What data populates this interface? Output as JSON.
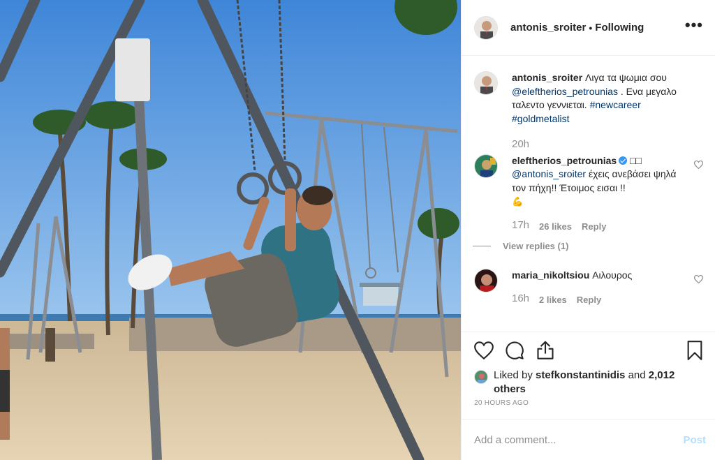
{
  "post": {
    "author": "antonis_sroiter",
    "follow_status": "Following",
    "more_label": "•••"
  },
  "caption": {
    "user": "antonis_sroiter",
    "text": "Λιγα τα ψωμια σου",
    "mention": "@eleftherios_petrounias",
    "text2": ". Ενα μεγαλο ταλεντο γεννιεται.",
    "tag1": "#newcareer",
    "tag2": "#goldmetalist",
    "time": "20h"
  },
  "comments": [
    {
      "user": "eleftherios_petrounias",
      "verified": true,
      "pre_text": "□□",
      "mention": "@antonis_sroiter",
      "text": "έχεις ανεβάσει ψηλά τον πήχη!! Έτοιμος εισαι !!",
      "emoji": "💪",
      "time": "17h",
      "likes": "26 likes",
      "reply": "Reply",
      "view_replies": "View replies (1)"
    },
    {
      "user": "maria_nikoltsiou",
      "text": "Αιλουρος",
      "time": "16h",
      "likes": "2 likes",
      "reply": "Reply"
    }
  ],
  "actions": {
    "icons": [
      "heart-icon",
      "comment-icon",
      "share-icon",
      "bookmark-icon"
    ]
  },
  "likes": {
    "prefix": "Liked by",
    "user": "stefkonstantinidis",
    "and": "and",
    "others": "2,012 others"
  },
  "timestamp": "20 HOURS AGO",
  "add_comment": {
    "placeholder": "Add a comment...",
    "post_label": "Post"
  },
  "colors": {
    "link": "#00376b",
    "meta": "#8e8e8e",
    "post_disabled": "#b2dffc",
    "verified": "#3897f0"
  }
}
